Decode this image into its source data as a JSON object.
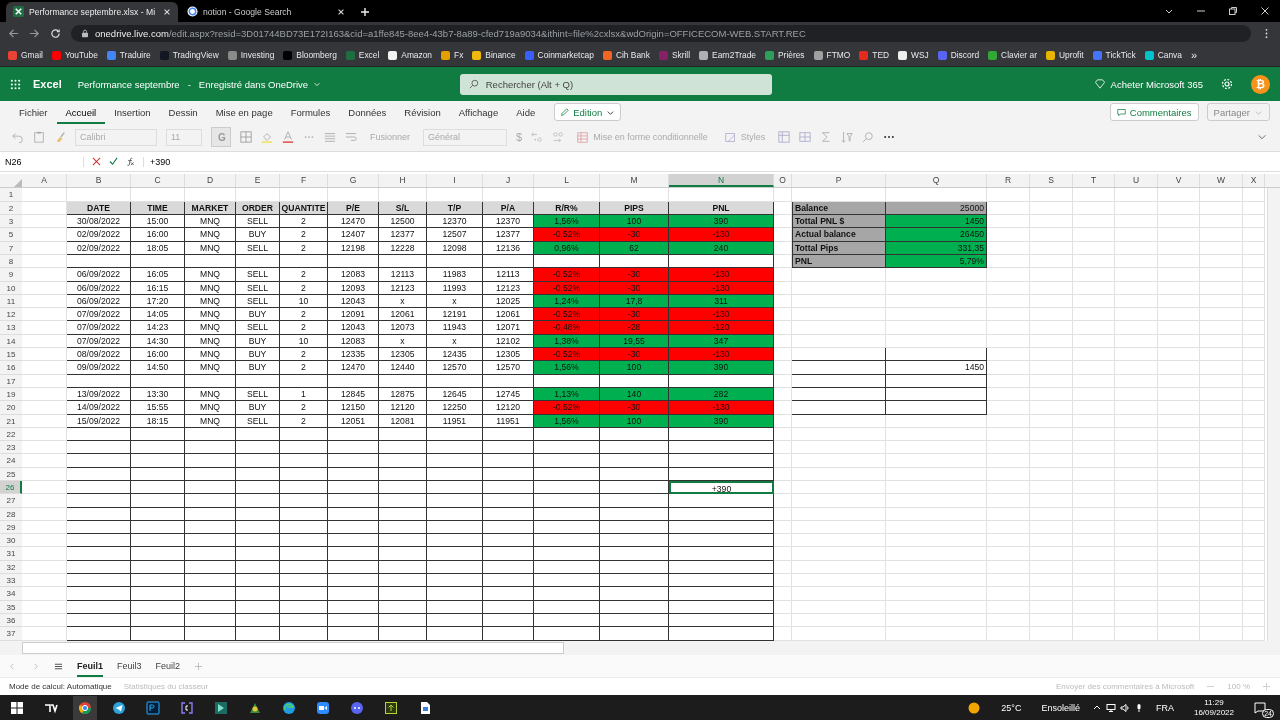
{
  "browser": {
    "tabs": [
      {
        "label": "Performance septembre.xlsx - Mi",
        "selected": true
      },
      {
        "label": "notion - Google Search",
        "selected": false
      }
    ],
    "url_host": "onedrive.live.com",
    "url_rest": "/edit.aspx?resid=3D01744BD73E172I163&cid=a1ffe845-8ee4-43b7-8a89-cfed719a9034&ithint=file%2cxlsx&wdOrigin=OFFICECOM-WEB.START.REC",
    "bookmarks": [
      {
        "label": "Gmail",
        "color": "#ea4335"
      },
      {
        "label": "YouTube",
        "color": "#ff0000"
      },
      {
        "label": "Traduire",
        "color": "#4285f4"
      },
      {
        "label": "TradingView",
        "color": "#131722"
      },
      {
        "label": "Investing",
        "color": "#8a8a8a"
      },
      {
        "label": "Bloomberg",
        "color": "#000000"
      },
      {
        "label": "Excel",
        "color": "#1d6f42"
      },
      {
        "label": "Amazon",
        "color": "#f2f2f2"
      },
      {
        "label": "Fx",
        "color": "#e5a000"
      },
      {
        "label": "Binance",
        "color": "#f0b90b"
      },
      {
        "label": "Coinmarketcap",
        "color": "#3861fb"
      },
      {
        "label": "Cih Bank",
        "color": "#f26522"
      },
      {
        "label": "Skrill",
        "color": "#862165"
      },
      {
        "label": "Earn2Trade",
        "color": "#b0b0b0"
      },
      {
        "label": "Prières",
        "color": "#2e9e5b"
      },
      {
        "label": "FTMO",
        "color": "#a0a0a0"
      },
      {
        "label": "TED",
        "color": "#e62b1e"
      },
      {
        "label": "WSJ",
        "color": "#eeeeee"
      },
      {
        "label": "Discord",
        "color": "#5865f2"
      },
      {
        "label": "Clavier ar",
        "color": "#31a836"
      },
      {
        "label": "Uprofit",
        "color": "#e8b400"
      },
      {
        "label": "TickTick",
        "color": "#4772fa"
      },
      {
        "label": "Canva",
        "color": "#00c4cc"
      }
    ],
    "bookmarks_more": "»"
  },
  "app": {
    "name": "Excel",
    "document": "Performance septembre",
    "separator": "-",
    "save_status": "Enregistré dans OneDrive",
    "search_placeholder": "Rechercher (Alt + Q)",
    "buy": "Acheter Microsoft 365",
    "avatar": "₿"
  },
  "ribbon": {
    "tabs": [
      {
        "label": "Fichier",
        "selected": false
      },
      {
        "label": "Accueil",
        "selected": true
      },
      {
        "label": "Insertion",
        "selected": false
      },
      {
        "label": "Dessin",
        "selected": false
      },
      {
        "label": "Mise en page",
        "selected": false
      },
      {
        "label": "Formules",
        "selected": false
      },
      {
        "label": "Données",
        "selected": false
      },
      {
        "label": "Révision",
        "selected": false
      },
      {
        "label": "Affichage",
        "selected": false
      },
      {
        "label": "Aide",
        "selected": false
      }
    ],
    "mode": "Edition",
    "comments": "Commentaires",
    "share": {
      "label": "Partager",
      "disabled": true
    }
  },
  "toolbar": {
    "disabled": true,
    "font": "Calibri",
    "size": "11",
    "bold": "G",
    "merge": "Fusionner",
    "number_format": "Général",
    "currency": "$",
    "conditional": "Mise en forme conditionnelle",
    "styles": "Styles"
  },
  "formula_bar": {
    "name_box": "N26",
    "formula": "+390"
  },
  "sheet": {
    "columns": [
      {
        "label": "A",
        "selected": false
      },
      {
        "label": "B",
        "selected": false
      },
      {
        "label": "C",
        "selected": false
      },
      {
        "label": "D",
        "selected": false
      },
      {
        "label": "E",
        "selected": false
      },
      {
        "label": "F",
        "selected": false
      },
      {
        "label": "G",
        "selected": false
      },
      {
        "label": "H",
        "selected": false
      },
      {
        "label": "I",
        "selected": false
      },
      {
        "label": "J",
        "selected": false
      },
      {
        "label": "L",
        "selected": false
      },
      {
        "label": "M",
        "selected": false
      },
      {
        "label": "N",
        "selected": true
      },
      {
        "label": "O",
        "selected": false
      },
      {
        "label": "P",
        "selected": false
      },
      {
        "label": "Q",
        "selected": false
      },
      {
        "label": "R",
        "selected": false
      },
      {
        "label": "S",
        "selected": false
      },
      {
        "label": "T",
        "selected": false
      },
      {
        "label": "U",
        "selected": false
      },
      {
        "label": "V",
        "selected": false
      },
      {
        "label": "W",
        "selected": false
      },
      {
        "label": "X",
        "selected": false
      }
    ],
    "rows": [
      {
        "label": "1",
        "selected": false,
        "in_table": false
      },
      {
        "label": "2",
        "selected": false,
        "in_table": true,
        "kind": "header",
        "cells": [
          "DATE",
          "TIME",
          "MARKET",
          "ORDER",
          "QUANTITE",
          "P/E",
          "S/L",
          "T/P",
          "P/A",
          "R/R%",
          "PIPS",
          "PNL"
        ],
        "summary": {
          "label": "Balance",
          "value": "25000",
          "color": "#a6a6a6"
        }
      },
      {
        "label": "3",
        "selected": false,
        "in_table": true,
        "kind": "trade",
        "color": "#00b050",
        "cells": [
          "30/08/2022",
          "15:00",
          "MNQ",
          "SELL",
          "2",
          "12470",
          "12500",
          "12370",
          "12370",
          "1,56%",
          "100",
          "390"
        ],
        "summary": {
          "label": "Tottal PNL $",
          "value": "1450",
          "color": "#00b050"
        }
      },
      {
        "label": "5",
        "selected": false,
        "in_table": true,
        "kind": "trade",
        "color": "#ff0000",
        "cells": [
          "02/09/2022",
          "16:00",
          "MNQ",
          "BUY",
          "2",
          "12407",
          "12377",
          "12507",
          "12377",
          "-0,52%",
          "-30",
          "-130"
        ],
        "summary": {
          "label": "Actual balance",
          "value": "26450",
          "color": "#00b050"
        }
      },
      {
        "label": "7",
        "selected": false,
        "in_table": true,
        "kind": "trade",
        "color": "#00b050",
        "cells": [
          "02/09/2022",
          "18:05",
          "MNQ",
          "SELL",
          "2",
          "12198",
          "12228",
          "12098",
          "12136",
          "0,96%",
          "62",
          "240"
        ],
        "summary": {
          "label": "Tottal Pips",
          "value": "331,35",
          "color": "#00b050"
        }
      },
      {
        "label": "8",
        "selected": false,
        "in_table": true,
        "summary": {
          "label": "PNL",
          "value": "5,79%",
          "color": "#00b050"
        }
      },
      {
        "label": "9",
        "selected": false,
        "in_table": true,
        "kind": "trade",
        "color": "#ff0000",
        "cells": [
          "06/09/2022",
          "16:05",
          "MNQ",
          "SELL",
          "2",
          "12083",
          "12113",
          "11983",
          "12113",
          "-0,52%",
          "-30",
          "-130"
        ]
      },
      {
        "label": "10",
        "selected": false,
        "in_table": true,
        "kind": "trade",
        "color": "#ff0000",
        "cells": [
          "06/09/2022",
          "16:15",
          "MNQ",
          "SELL",
          "2",
          "12093",
          "12123",
          "11993",
          "12123",
          "-0,52%",
          "-30",
          "-130"
        ]
      },
      {
        "label": "11",
        "selected": false,
        "in_table": true,
        "kind": "trade",
        "color": "#00b050",
        "cells": [
          "06/09/2022",
          "17:20",
          "MNQ",
          "SELL",
          "10",
          "12043",
          "x",
          "x",
          "12025",
          "1,24%",
          "17,8",
          "311"
        ]
      },
      {
        "label": "12",
        "selected": false,
        "in_table": true,
        "kind": "trade",
        "color": "#ff0000",
        "cells": [
          "07/09/2022",
          "14:05",
          "MNQ",
          "BUY",
          "2",
          "12091",
          "12061",
          "12191",
          "12061",
          "-0,52%",
          "-30",
          "-130"
        ]
      },
      {
        "label": "13",
        "selected": false,
        "in_table": true,
        "kind": "trade",
        "color": "#ff0000",
        "cells": [
          "07/09/2022",
          "14:23",
          "MNQ",
          "SELL",
          "2",
          "12043",
          "12073",
          "11943",
          "12071",
          "-0,48%",
          "-28",
          "-120"
        ]
      },
      {
        "label": "14",
        "selected": false,
        "in_table": true,
        "kind": "trade",
        "color": "#00b050",
        "cells": [
          "07/09/2022",
          "14:30",
          "MNQ",
          "BUY",
          "10",
          "12083",
          "x",
          "x",
          "12102",
          "1,38%",
          "19,55",
          "347"
        ]
      },
      {
        "label": "15",
        "selected": false,
        "in_table": true,
        "kind": "trade",
        "color": "#ff0000",
        "cells": [
          "08/09/2022",
          "16:00",
          "MNQ",
          "BUY",
          "2",
          "12335",
          "12305",
          "12435",
          "12305",
          "-0,52%",
          "-30",
          "-130"
        ],
        "box": true
      },
      {
        "label": "16",
        "selected": false,
        "in_table": true,
        "kind": "trade",
        "color": "#00b050",
        "cells": [
          "09/09/2022",
          "14:50",
          "MNQ",
          "BUY",
          "2",
          "12470",
          "12440",
          "12570",
          "12570",
          "1,56%",
          "100",
          "390"
        ],
        "box": true,
        "box_value": "1450"
      },
      {
        "label": "17",
        "selected": false,
        "in_table": true,
        "box": true
      },
      {
        "label": "19",
        "selected": false,
        "in_table": true,
        "kind": "trade",
        "color": "#00b050",
        "cells": [
          "13/09/2022",
          "13:30",
          "MNQ",
          "SELL",
          "1",
          "12845",
          "12875",
          "12645",
          "12745",
          "1,13%",
          "140",
          "282"
        ],
        "box": true
      },
      {
        "label": "20",
        "selected": false,
        "in_table": true,
        "kind": "trade",
        "color": "#ff0000",
        "cells": [
          "14/09/2022",
          "15:55",
          "MNQ",
          "BUY",
          "2",
          "12150",
          "12120",
          "12250",
          "12120",
          "-0,52%",
          "-30",
          "-130"
        ],
        "box": true
      },
      {
        "label": "21",
        "selected": false,
        "in_table": true,
        "kind": "trade",
        "color": "#00b050",
        "cells": [
          "15/09/2022",
          "18:15",
          "MNQ",
          "SELL",
          "2",
          "12051",
          "12081",
          "11951",
          "11951",
          "1,56%",
          "100",
          "390"
        ]
      },
      {
        "label": "22",
        "selected": false,
        "in_table": true
      },
      {
        "label": "23",
        "selected": false,
        "in_table": true
      },
      {
        "label": "24",
        "selected": false,
        "in_table": true
      },
      {
        "label": "25",
        "selected": false,
        "in_table": true
      },
      {
        "label": "26",
        "selected": true,
        "in_table": true,
        "entry": "+390"
      },
      {
        "label": "27",
        "selected": false,
        "in_table": true
      },
      {
        "label": "28",
        "selected": false,
        "in_table": true
      },
      {
        "label": "29",
        "selected": false,
        "in_table": true
      },
      {
        "label": "30",
        "selected": false,
        "in_table": true
      },
      {
        "label": "31",
        "selected": false,
        "in_table": true
      },
      {
        "label": "32",
        "selected": false,
        "in_table": true
      },
      {
        "label": "33",
        "selected": false,
        "in_table": true
      },
      {
        "label": "34",
        "selected": false,
        "in_table": true
      },
      {
        "label": "35",
        "selected": false,
        "in_table": true
      },
      {
        "label": "36",
        "selected": false,
        "in_table": true
      },
      {
        "label": "37",
        "selected": false,
        "in_table": true
      }
    ]
  },
  "sheet_tabs": [
    {
      "label": "Feuil1",
      "selected": true
    },
    {
      "label": "Feuil3",
      "selected": false
    },
    {
      "label": "Feuil2",
      "selected": false
    }
  ],
  "status_bar": {
    "calc_mode": "Mode de calcul: Automatique",
    "stats": "Statistiques du classeur",
    "feedback": "Envoyer des commentaires à Microsoft",
    "zoom": "100 %"
  },
  "taskbar": {
    "temperature": "25°C",
    "weather": "Ensoleillé",
    "language": "FRA",
    "time": "11:29",
    "date": "16/09/2022",
    "notifications": "24"
  }
}
